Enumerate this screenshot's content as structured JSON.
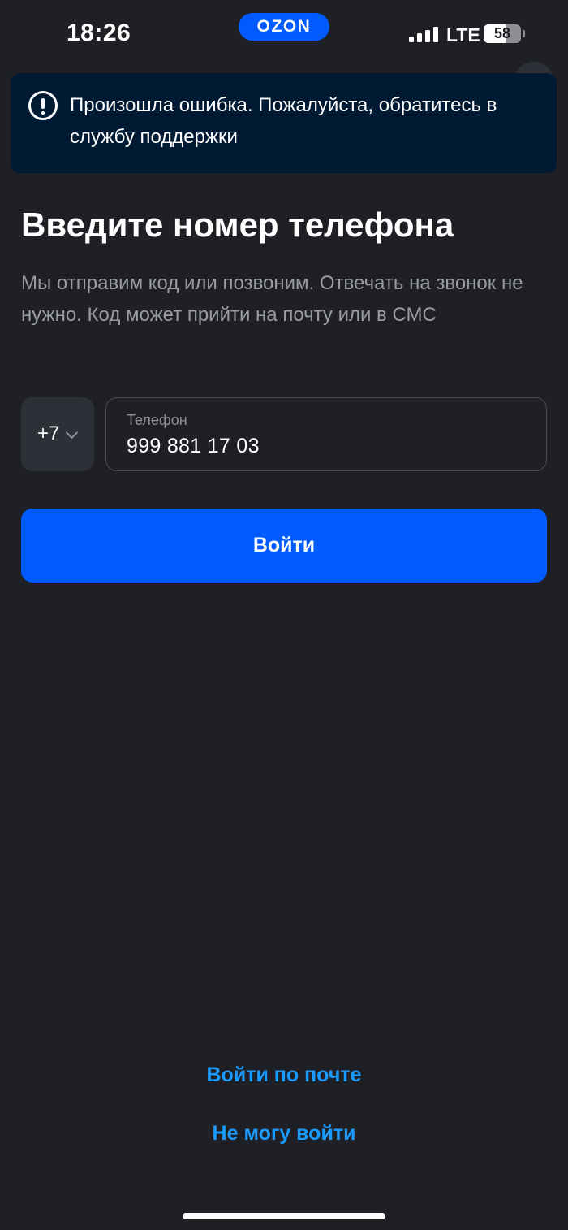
{
  "status_bar": {
    "time": "18:26",
    "brand": "OZON",
    "network": "LTE",
    "battery": "58",
    "brand_color": "#005bff"
  },
  "toast": {
    "message": "Произошла ошибка. Пожалуйста, обратитесь в службу поддержки",
    "icon": "alert-circle-icon",
    "background": "#001a34"
  },
  "login": {
    "title": "Введите номер телефона",
    "subtitle": "Мы отправим код или позвоним. Отвечать на звонок не нужно. Код может прийти на почту или в СМС",
    "country_code": "+7",
    "phone_label": "Телефон",
    "phone_value": "999 881 17 03",
    "submit_label": "Войти",
    "accent_color": "#005bff"
  },
  "links": {
    "email_login": "Войти по почте",
    "cant_login": "Не могу войти",
    "link_color": "#1a9bff"
  }
}
